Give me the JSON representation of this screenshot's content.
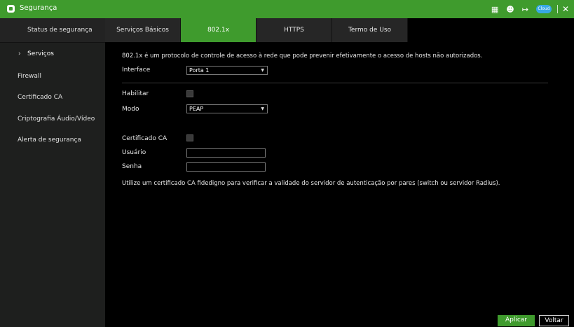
{
  "window": {
    "title": "Segurança"
  },
  "toolbar": {
    "icons": [
      "grid-calendar-icon",
      "users-icon",
      "logout-icon",
      "cloud-icon",
      "close-icon"
    ],
    "cloud_badge": "Cloud"
  },
  "sidebar": {
    "items": [
      {
        "label": "Status de segurança"
      },
      {
        "label": "Serviços",
        "active": true
      },
      {
        "label": "Firewall"
      },
      {
        "label": "Certificado CA"
      },
      {
        "label": "Criptografia Áudio/Vídeo"
      },
      {
        "label": "Alerta de segurança"
      }
    ]
  },
  "tabs": [
    {
      "label": "Serviços Básicos"
    },
    {
      "label": "802.1x",
      "active": true
    },
    {
      "label": "HTTPS"
    },
    {
      "label": "Termo de Uso"
    }
  ],
  "form": {
    "description": "802.1x é um protocolo de controle de acesso à rede que pode prevenir efetivamente o acesso de hosts não autorizados.",
    "interface_label": "Interface",
    "interface_value": "Porta 1",
    "enable_label": "Habilitar",
    "enable_checked": false,
    "mode_label": "Modo",
    "mode_value": "PEAP",
    "ca_cert_label": "Certificado CA",
    "ca_cert_checked": false,
    "user_label": "Usuário",
    "user_value": "",
    "password_label": "Senha",
    "password_value": "",
    "note": "Utilize um certificado CA fidedigno para verificar a validade do servidor de autenticação por pares (switch ou servidor Radius)."
  },
  "buttons": {
    "apply": "Aplicar",
    "back": "Voltar"
  },
  "colors": {
    "accent": "#3f9b2d",
    "sidebar_bg": "#1e1f1e",
    "tab_bg": "#262626"
  }
}
